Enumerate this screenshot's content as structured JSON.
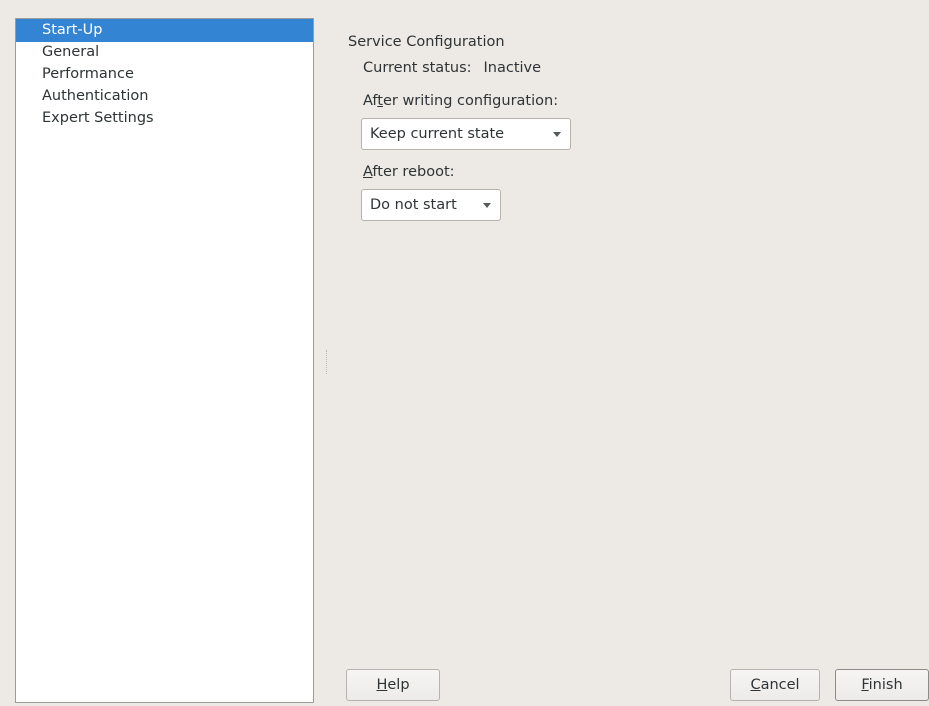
{
  "sidebar": {
    "items": [
      {
        "label": "Start-Up"
      },
      {
        "label": "General"
      },
      {
        "label": "Performance"
      },
      {
        "label": "Authentication"
      },
      {
        "label": "Expert Settings"
      }
    ],
    "selected": "Start-Up"
  },
  "service": {
    "title": "Service Configuration",
    "status_label": "Current status:",
    "status_value": "Inactive",
    "after_write": {
      "label_pre": "Af",
      "label_mnemonic": "t",
      "label_post": "er writing configuration:",
      "value": "Keep current state"
    },
    "after_reboot": {
      "label_mnemonic": "A",
      "label_post": "fter reboot:",
      "value": "Do not start"
    }
  },
  "buttons": {
    "help": {
      "mnemonic": "H",
      "rest": "elp"
    },
    "cancel": {
      "mnemonic": "C",
      "rest": "ancel"
    },
    "finish": {
      "mnemonic": "F",
      "rest": "inish"
    }
  },
  "colors": {
    "window_bg": "#edeae6",
    "selection": "#3484d4",
    "panel_bg": "#ffffff"
  }
}
